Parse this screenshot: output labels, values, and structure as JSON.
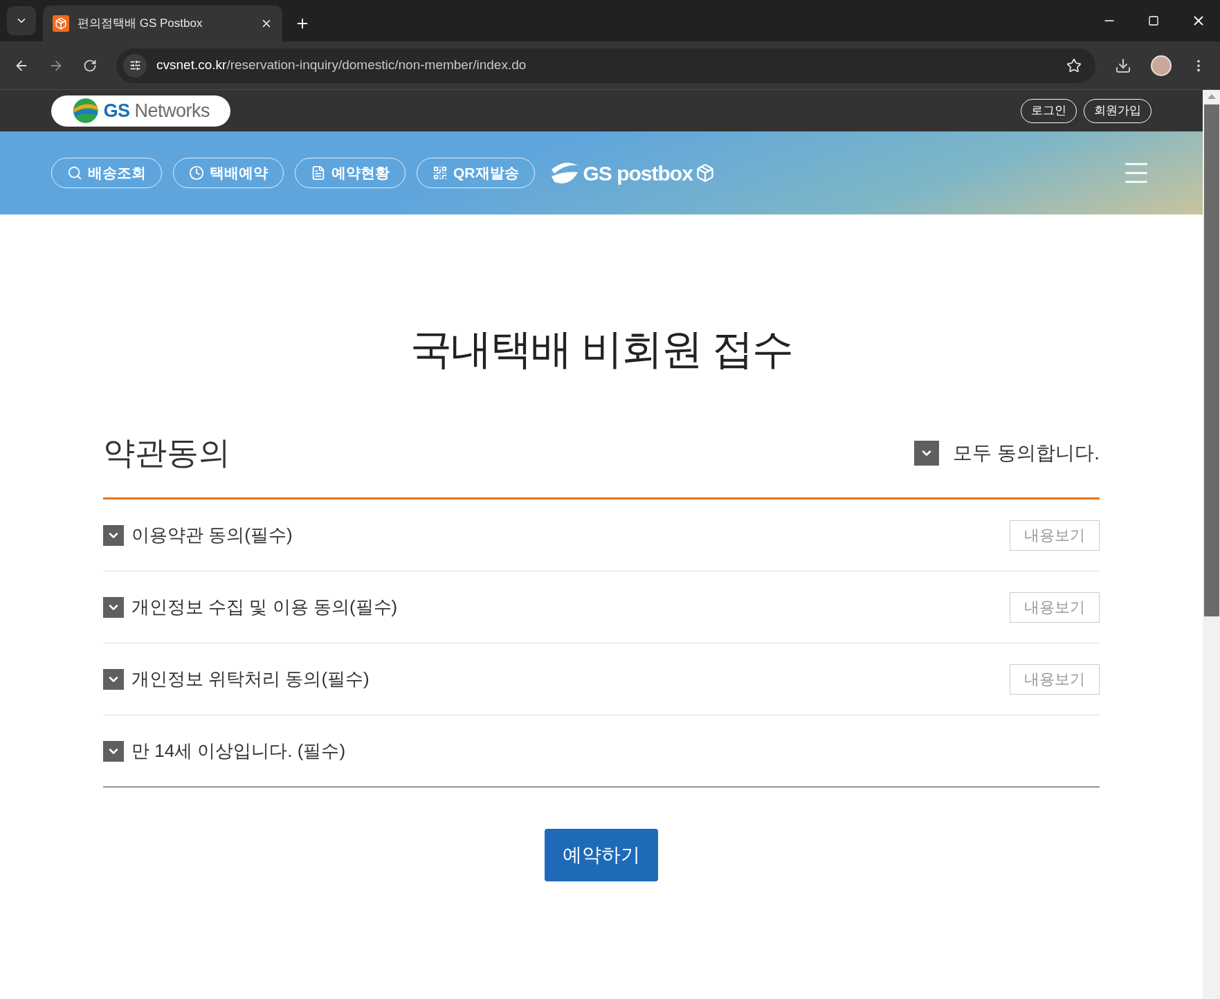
{
  "browser": {
    "tab": {
      "title": "편의점택배 GS Postbox",
      "selected": true
    },
    "url_host": "cvsnet.co.kr",
    "url_path": "/reservation-inquiry/domestic/non-member/index.do"
  },
  "topbar": {
    "logo": {
      "brand": "GS",
      "name": "Networks"
    },
    "buttons": [
      "로그인",
      "회원가입"
    ]
  },
  "nav": {
    "items": [
      {
        "kind": "search",
        "label": "배송조회"
      },
      {
        "kind": "clock",
        "label": "택배예약"
      },
      {
        "kind": "doc",
        "label": "예약현황"
      },
      {
        "kind": "qr",
        "label": "QR재발송"
      }
    ],
    "logo": "GS postbox"
  },
  "page_title": "국내택배 비회원 접수",
  "terms": {
    "heading": "약관동의",
    "agree_all": {
      "label": "모두 동의합니다.",
      "checked": true
    },
    "items": [
      {
        "label": "이용약관 동의(필수)",
        "checked": true,
        "view": "내용보기"
      },
      {
        "label": "개인정보 수집 및 이용 동의(필수)",
        "checked": true,
        "view": "내용보기"
      },
      {
        "label": "개인정보 위탁처리 동의(필수)",
        "checked": true,
        "view": "내용보기"
      },
      {
        "label": "만 14세 이상입니다. (필수)",
        "checked": true
      }
    ]
  },
  "submit": "예약하기"
}
